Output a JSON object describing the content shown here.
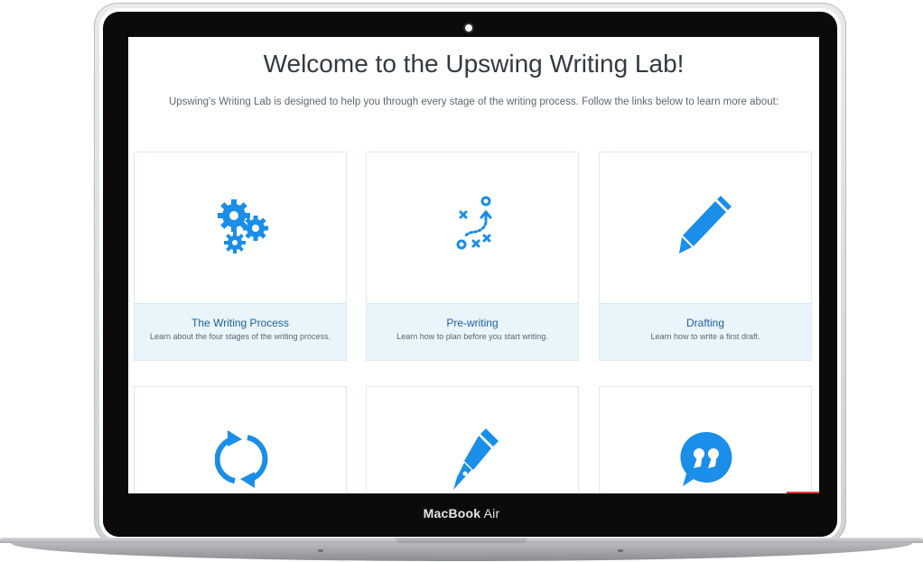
{
  "device": {
    "label_bold": "MacBook",
    "label_light": "Air"
  },
  "page": {
    "title": "Welcome to the Upswing Writing Lab!",
    "subtitle": "Upswing's Writing Lab is designed to help you through every stage of the writing process. Follow the links below to learn more about:"
  },
  "cards": [
    {
      "title": "The Writing Process",
      "description": "Learn about the four stages of the writing process.",
      "icon": "gears-icon"
    },
    {
      "title": "Pre-writing",
      "description": "Learn how to plan before you start writing.",
      "icon": "strategy-play-icon"
    },
    {
      "title": "Drafting",
      "description": "Learn how to write a first draft.",
      "icon": "pencil-icon"
    },
    {
      "title": "",
      "description": "",
      "icon": "revision-cycle-icon"
    },
    {
      "title": "",
      "description": "",
      "icon": "fountain-pen-icon"
    },
    {
      "title": "",
      "description": "",
      "icon": "quote-bubble-icon"
    }
  ],
  "colors": {
    "accent": "#1a8ee8",
    "caption_bg": "#e9f4fb",
    "title_link": "#1f5f99"
  }
}
